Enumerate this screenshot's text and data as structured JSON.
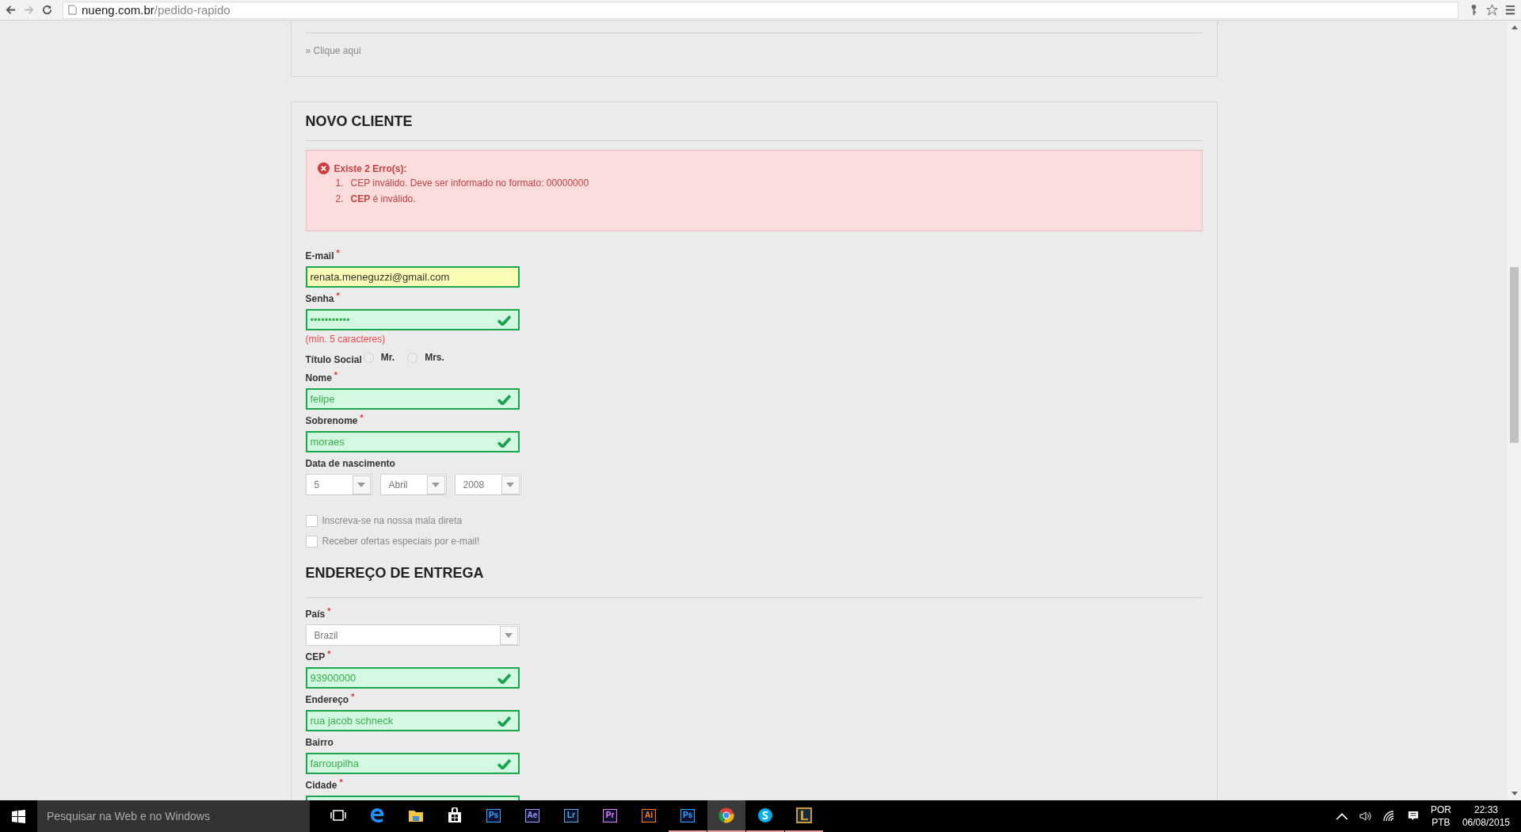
{
  "browser": {
    "url_host": "nueng.com.br",
    "url_path": "/pedido-rapido"
  },
  "previous_panel": {
    "link": "» Clique aqui"
  },
  "novo_cliente": {
    "title": "NOVO CLIENTE",
    "errors": {
      "heading": "Existe 2 Erro(s):",
      "items": [
        {
          "number": "1.",
          "text": "CEP inválido. Deve ser informado no formato: 00000000"
        },
        {
          "number": "2.",
          "text": "**CEP** é inválido."
        }
      ]
    },
    "fields": [
      {
        "kind": "text",
        "label": "E-mail",
        "required_mark": "*",
        "value": "renata.meneguzzi@gmail.com",
        "autofilled": true,
        "valid": false
      },
      {
        "kind": "text",
        "label": "Senha",
        "required_mark": "*",
        "value": "•••••••••••",
        "autofilled": false,
        "valid": true,
        "hint": "(mín. 5 caracteres)"
      },
      {
        "kind": "radio",
        "label": "Título Social",
        "options": [
          {
            "label": "Mr.",
            "selected": false
          },
          {
            "label": "Mrs.",
            "selected": false
          }
        ]
      },
      {
        "kind": "text",
        "label": "Nome",
        "required_mark": "*",
        "value": "felipe",
        "autofilled": false,
        "valid": true
      },
      {
        "kind": "text",
        "label": "Sobrenome",
        "required_mark": "*",
        "value": "moraes",
        "autofilled": false,
        "valid": true
      },
      {
        "kind": "date",
        "label": "Data de nascimento",
        "selects": [
          "5",
          "Abril",
          "2008"
        ]
      },
      {
        "kind": "checkbox",
        "label": "Inscreva-se na nossa mala direta",
        "checked": false
      },
      {
        "kind": "checkbox",
        "label": "Receber ofertas especiais por e-mail!",
        "checked": false
      }
    ]
  },
  "endereco": {
    "title": "ENDEREÇO DE ENTREGA",
    "fields": [
      {
        "kind": "select",
        "label": "País",
        "required_mark": "*",
        "value": "Brazil"
      },
      {
        "kind": "text",
        "label": "CEP",
        "required_mark": "*",
        "value": "93900000",
        "autofilled": false,
        "valid": true
      },
      {
        "kind": "text",
        "label": "Endereço",
        "required_mark": "*",
        "value": "rua jacob schneck",
        "autofilled": false,
        "valid": true
      },
      {
        "kind": "text",
        "label": "Bairro",
        "value": "farroupilha",
        "autofilled": false,
        "valid": true
      },
      {
        "kind": "text",
        "label": "Cidade",
        "required_mark": "*",
        "autofilled": false,
        "valid": true
      }
    ]
  },
  "taskbar": {
    "search_placeholder": "Pesquisar na Web e no Windows",
    "apps": [
      {
        "kind": "taskview",
        "running": false,
        "active": false
      },
      {
        "kind": "edge",
        "running": false,
        "active": false
      },
      {
        "kind": "folder",
        "running": false,
        "active": false
      },
      {
        "kind": "store",
        "running": false,
        "active": false
      },
      {
        "kind": "tile",
        "label": "Ps",
        "color": "#31a8ff",
        "running": false,
        "active": false
      },
      {
        "kind": "tile",
        "label": "Ae",
        "color": "#9999ff",
        "running": false,
        "active": false
      },
      {
        "kind": "tile",
        "label": "Lr",
        "color": "#5aa9d8",
        "running": false,
        "active": false
      },
      {
        "kind": "tile",
        "label": "Pr",
        "color": "#e77cf7",
        "running": false,
        "active": false
      },
      {
        "kind": "tile",
        "label": "Ai",
        "color": "#ff7c00",
        "running": false,
        "active": false
      },
      {
        "kind": "tile",
        "label": "Ps",
        "color": "#31a8ff",
        "running": true,
        "active": false
      },
      {
        "kind": "chrome",
        "running": true,
        "active": true
      },
      {
        "kind": "skype",
        "running": true,
        "active": false
      },
      {
        "kind": "game",
        "running": true,
        "active": false
      }
    ],
    "language": [
      "POR",
      "PTB"
    ],
    "time": "22:33",
    "date": "06/08/2015"
  }
}
